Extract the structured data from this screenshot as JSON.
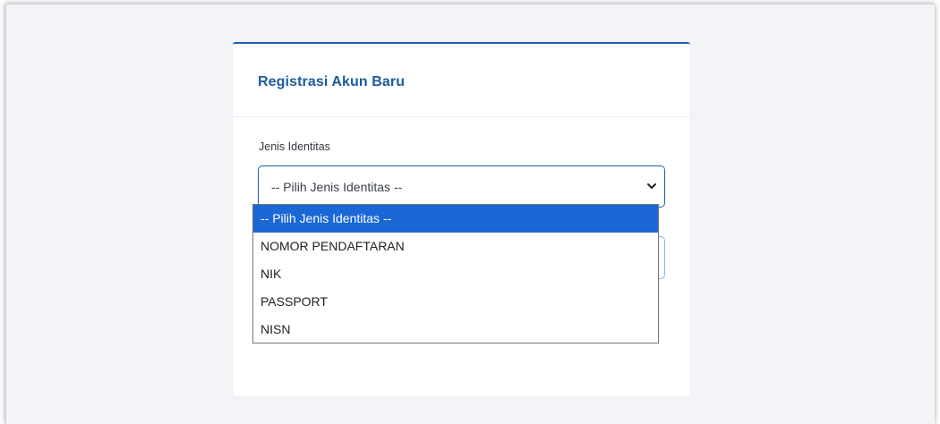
{
  "card": {
    "title": "Registrasi Akun Baru"
  },
  "form": {
    "identity_label": "Jenis Identitas",
    "identity_select": {
      "value": "-- Pilih Jenis Identitas --",
      "options": [
        "-- Pilih Jenis Identitas --",
        "NOMOR PENDAFTARAN",
        "NIK",
        "PASSPORT",
        "NISN"
      ],
      "selected_index": 0
    }
  },
  "colors": {
    "accent": "#1d5fa8",
    "title": "#1d5b9c",
    "option_highlight": "#1a67d6",
    "background": "#f3f4f8"
  },
  "icons": {
    "select_arrow": "chevron-down-icon"
  }
}
